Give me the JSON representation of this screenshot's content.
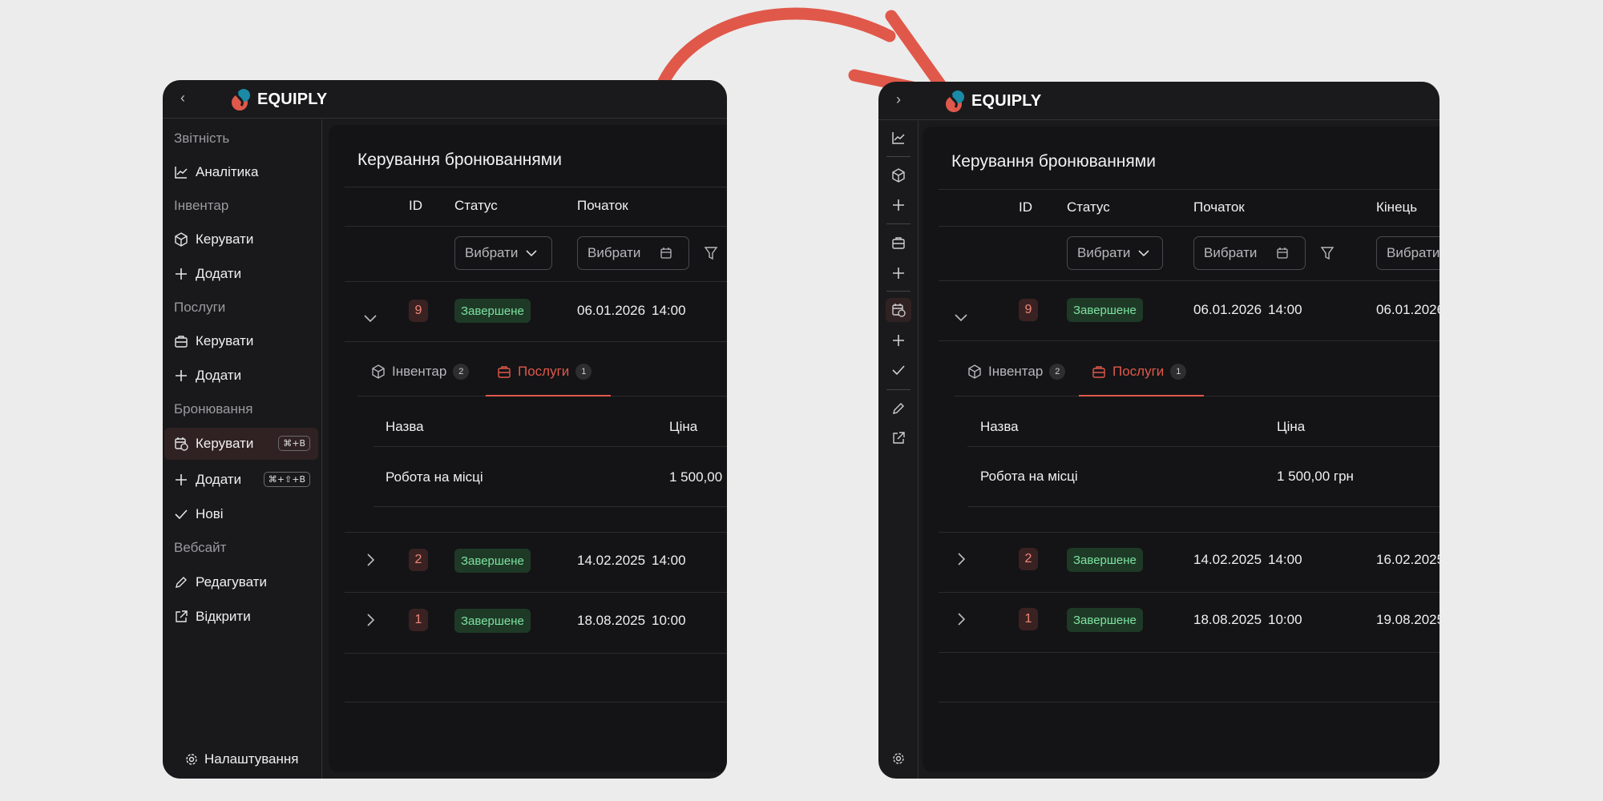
{
  "brand": {
    "name": "EQUIPLY",
    "accent": "#e0584a"
  },
  "sidebar": {
    "sections": [
      {
        "title": "Звітність",
        "items": [
          {
            "label": "Аналітика",
            "icon": "chart-icon"
          }
        ]
      },
      {
        "title": "Інвентар",
        "items": [
          {
            "label": "Керувати",
            "icon": "box-icon"
          },
          {
            "label": "Додати",
            "icon": "plus-icon"
          }
        ]
      },
      {
        "title": "Послуги",
        "items": [
          {
            "label": "Керувати",
            "icon": "briefcase-icon"
          },
          {
            "label": "Додати",
            "icon": "plus-icon"
          }
        ]
      },
      {
        "title": "Бронювання",
        "items": [
          {
            "label": "Керувати",
            "icon": "calendar-clock-icon",
            "shortcut": "⌘+B",
            "active": true
          },
          {
            "label": "Додати",
            "icon": "plus-icon",
            "shortcut": "⌘+⇧+B"
          },
          {
            "label": "Нові",
            "icon": "check-icon"
          }
        ]
      },
      {
        "title": "Вебсайт",
        "items": [
          {
            "label": "Редагувати",
            "icon": "pencil-icon"
          },
          {
            "label": "Відкрити",
            "icon": "external-link-icon"
          }
        ]
      }
    ],
    "settings_label": "Налаштування"
  },
  "main": {
    "title": "Керування бронюваннями",
    "columns": {
      "id": "ID",
      "status": "Статус",
      "start": "Початок",
      "end": "Кінець"
    },
    "filter_placeholder": "Вибрати",
    "rows": [
      {
        "id": "9",
        "status": "Завершене",
        "start_date": "06.01.2026",
        "start_time": "14:00",
        "end_date": "06.01.2026",
        "expanded": true
      },
      {
        "id": "2",
        "status": "Завершене",
        "start_date": "14.02.2025",
        "start_time": "14:00",
        "end_date": "16.02.2025"
      },
      {
        "id": "1",
        "status": "Завершене",
        "start_date": "18.08.2025",
        "start_time": "10:00",
        "end_date": "19.08.2025"
      }
    ],
    "detail": {
      "tabs": [
        {
          "label": "Інвентар",
          "count": "2"
        },
        {
          "label": "Послуги",
          "count": "1",
          "active": true
        }
      ],
      "columns": {
        "name": "Назва",
        "price": "Ціна"
      },
      "items": [
        {
          "name": "Робота на місці",
          "price": "1 500,00 грн"
        }
      ]
    }
  }
}
